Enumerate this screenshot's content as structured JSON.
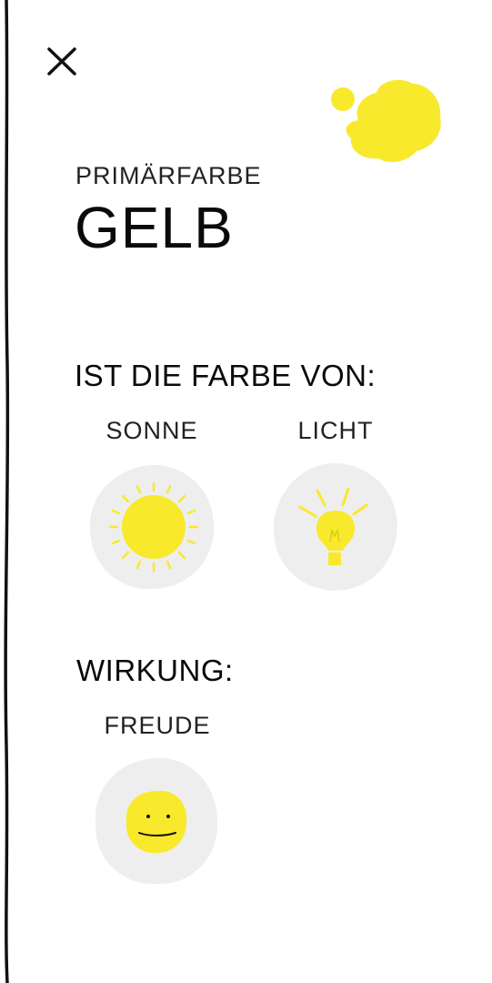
{
  "header": {
    "close_icon": "close-icon",
    "eyebrow": "PRIMÄRFARBE",
    "title": "GELB"
  },
  "colors": {
    "accent": "#f8e92c",
    "card_bg": "#eeeeee",
    "text": "#0a0a0a"
  },
  "sections": {
    "color_of": {
      "heading": "IST DIE FARBE VON:",
      "items": [
        {
          "label": "SONNE",
          "icon": "sun-icon"
        },
        {
          "label": "LICHT",
          "icon": "lightbulb-icon"
        }
      ]
    },
    "effect": {
      "heading": "WIRKUNG:",
      "items": [
        {
          "label": "FREUDE",
          "icon": "smiley-icon"
        }
      ]
    }
  }
}
